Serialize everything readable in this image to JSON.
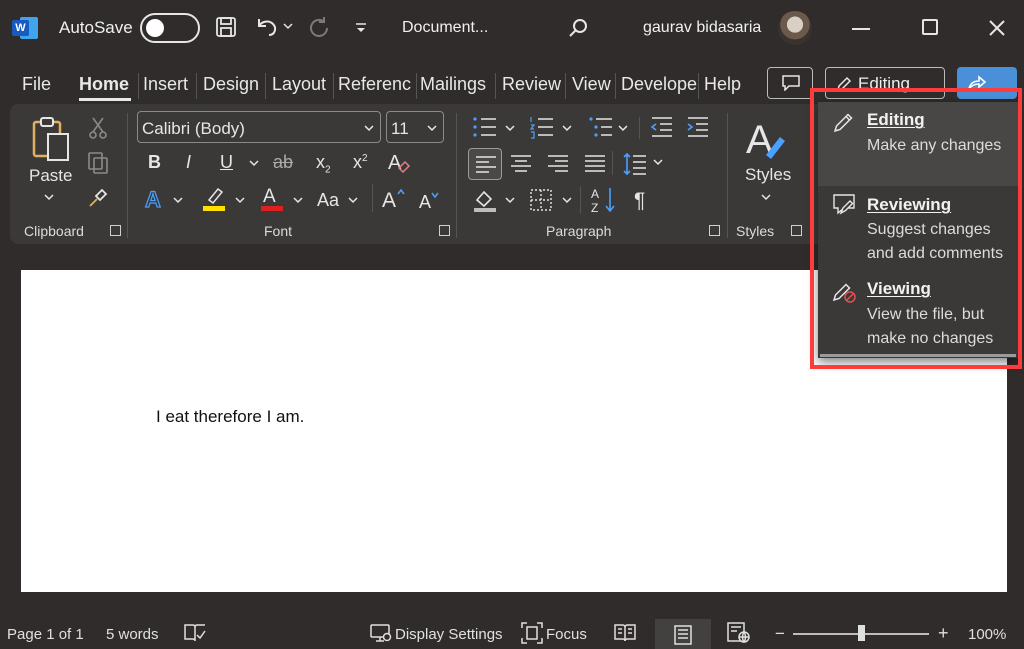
{
  "titlebar": {
    "autosave_label": "AutoSave",
    "autosave_state": "off",
    "document_title": "Document...",
    "user_name": "gaurav bidasaria",
    "app_letter": "W"
  },
  "tabs": [
    "File",
    "Home",
    "Insert",
    "Design",
    "Layout",
    "Referenc",
    "Mailings",
    "Review",
    "View",
    "Develope",
    "Help"
  ],
  "active_tab": "Home",
  "mode_button_label": "Editing",
  "ribbon": {
    "clipboard": {
      "paste_label": "Paste",
      "group_label": "Clipboard"
    },
    "font": {
      "font_name": "Calibri (Body)",
      "font_size": "11",
      "group_label": "Font",
      "change_case": "Aa"
    },
    "paragraph": {
      "group_label": "Paragraph"
    },
    "styles": {
      "label": "Styles",
      "group_label": "Styles"
    }
  },
  "document": {
    "text": "I eat therefore I am."
  },
  "mode_menu": [
    {
      "title": "Editing",
      "desc_line1": "Make any changes",
      "desc_line2": ""
    },
    {
      "title": "Reviewing",
      "desc_line1": "Suggest changes",
      "desc_line2": "and add comments"
    },
    {
      "title": "Viewing",
      "desc_line1": "View the file, but",
      "desc_line2": "make no changes"
    }
  ],
  "statusbar": {
    "page": "Page 1 of 1",
    "words": "5 words",
    "display_settings": "Display Settings",
    "focus": "Focus",
    "zoom": "100%",
    "zoom_minus": "−",
    "zoom_plus": "+"
  },
  "colors": {
    "highlight_box": "#ff3b3b",
    "highlight_yellow": "#ffe000",
    "font_red": "#e02020",
    "text_effects_blue": "#4aa0ff"
  }
}
